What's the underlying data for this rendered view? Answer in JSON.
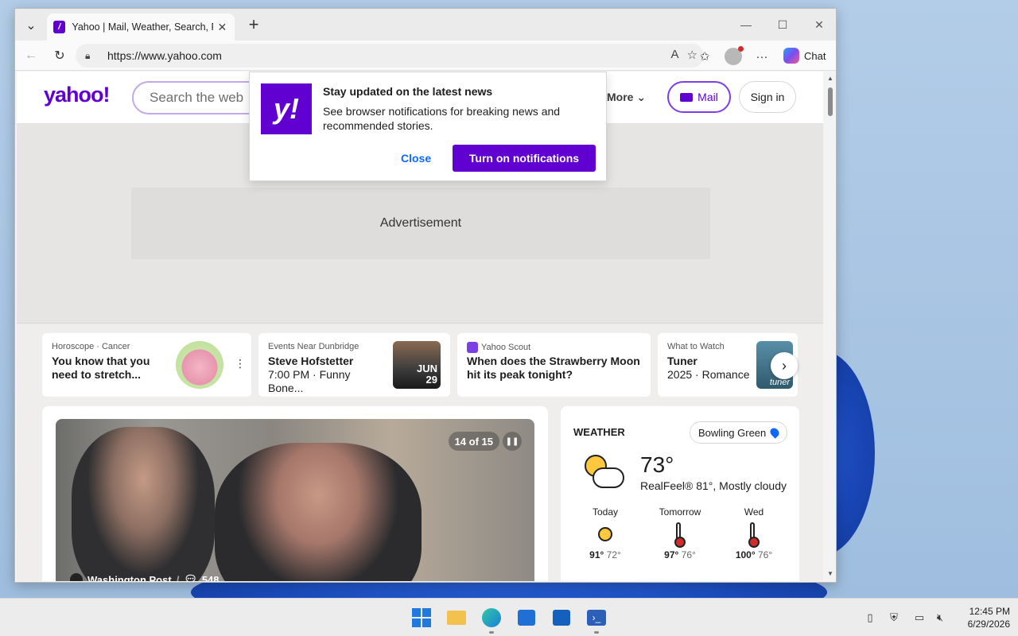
{
  "browser": {
    "tab_title": "Yahoo | Mail, Weather, Search, Politics",
    "url": "https://www.yahoo.com",
    "chat_label": "Chat"
  },
  "header": {
    "logo": "yahoo!",
    "search_placeholder": "Search the web",
    "more_label": "More",
    "mail_label": "Mail",
    "signin_label": "Sign in"
  },
  "notification": {
    "logo": "y!",
    "title": "Stay updated on the latest news",
    "text": "See browser notifications for breaking news and recommended stories.",
    "close_label": "Close",
    "turn_on_label": "Turn on notifications"
  },
  "ad": {
    "label": "Advertisement"
  },
  "cards": [
    {
      "kicker": "Horoscope · Cancer",
      "title": "You know that you need to stretch..."
    },
    {
      "kicker": "Events Near Dunbridge",
      "title": "Steve Hofstetter",
      "sub": "7:00 PM · Funny Bone...",
      "date_month": "JUN",
      "date_day": "29"
    },
    {
      "kicker": "Yahoo Scout",
      "title": "When does the Strawberry Moon hit its peak tonight?"
    },
    {
      "kicker": "What to Watch",
      "title": "Tuner",
      "sub": "2025 · Romance",
      "img_text": "tuner"
    }
  ],
  "hero": {
    "counter": "14 of 15",
    "source": "Washington Post",
    "comments": "548"
  },
  "weather": {
    "title": "WEATHER",
    "location": "Bowling Green",
    "temp": "73°",
    "desc": "RealFeel® 81°, Mostly cloudy",
    "forecast": [
      {
        "day": "Today",
        "hi": "91°",
        "lo": "72°"
      },
      {
        "day": "Tomorrow",
        "hi": "97°",
        "lo": "76°"
      },
      {
        "day": "Wed",
        "hi": "100°",
        "lo": "76°"
      }
    ]
  },
  "taskbar": {
    "time": "12:45 PM",
    "date": "6/29/2026"
  }
}
